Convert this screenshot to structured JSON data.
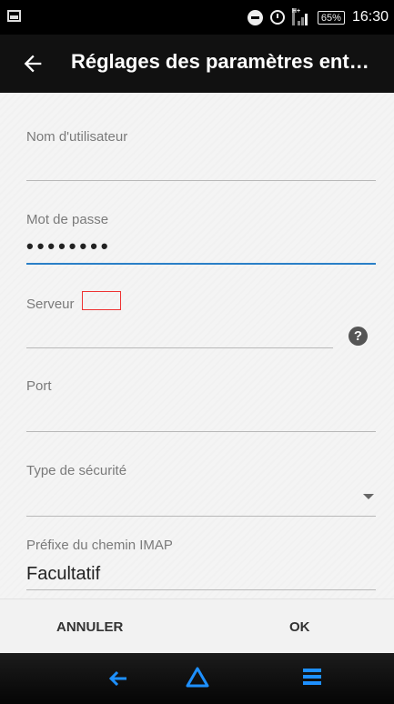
{
  "statusbar": {
    "network": "H+",
    "battery": "65%",
    "time": "16:30"
  },
  "appbar": {
    "title": "Réglages des paramètres ent…",
    "back_icon": "arrow-left-icon"
  },
  "form": {
    "username_label": "Nom d'utilisateur",
    "username_value": "",
    "password_label": "Mot de passe",
    "password_value": "••••••••",
    "server_label": "Serveur",
    "server_value": "",
    "help_glyph": "?",
    "port_label": "Port",
    "port_value": "",
    "security_label": "Type de sécurité",
    "security_value": "",
    "prefix_label": "Préfixe du chemin IMAP",
    "prefix_placeholder": "Facultatif"
  },
  "actions": {
    "cancel_label": "ANNULER",
    "ok_label": "OK"
  },
  "navbar": {
    "back_icon": "nav-back-icon",
    "home_icon": "home-icon",
    "menu_icon": "menu-icon",
    "accent_color": "#1e90ff"
  }
}
